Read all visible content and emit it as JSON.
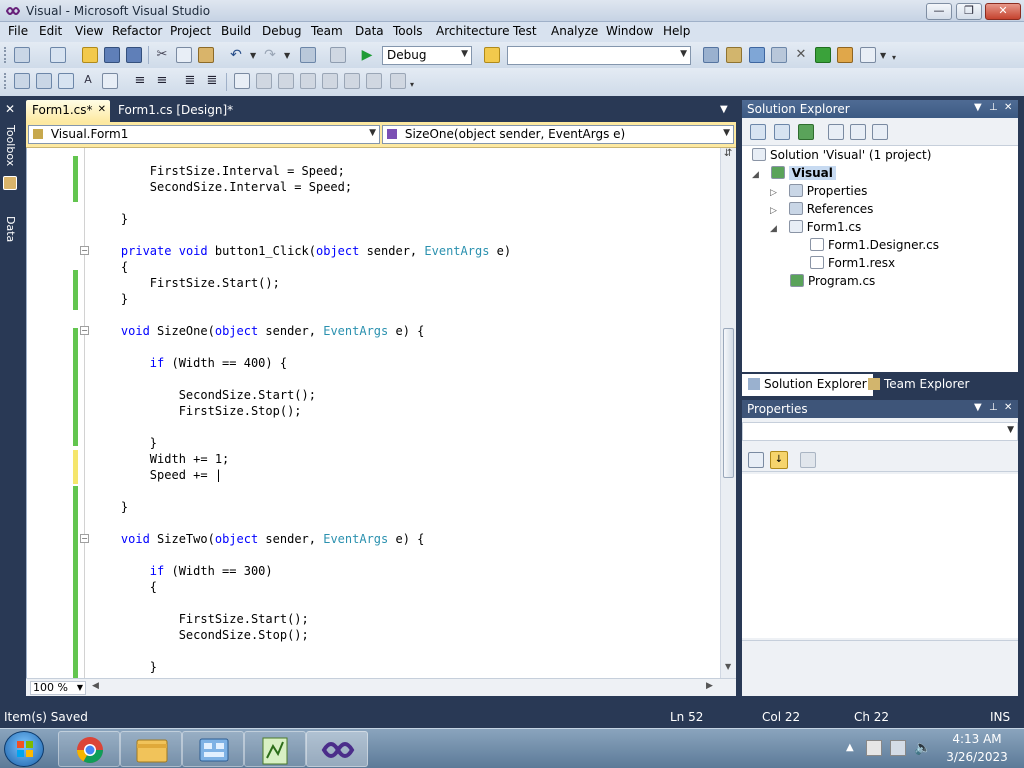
{
  "window": {
    "title": "Visual - Microsoft Visual Studio",
    "minimize": "—",
    "maximize": "❐",
    "close": "✕"
  },
  "menu": [
    "File",
    "Edit",
    "View",
    "Refactor",
    "Project",
    "Build",
    "Debug",
    "Team",
    "Data",
    "Tools",
    "Architecture",
    "Test",
    "Analyze",
    "Window",
    "Help"
  ],
  "toolbar": {
    "configuration": "Debug",
    "search_value": ""
  },
  "side_tabs": {
    "toolbox": "Toolbox",
    "data_sources": "Data Sources"
  },
  "doc_tabs": [
    {
      "label": "Form1.cs*",
      "close": "✕"
    },
    {
      "label": "Form1.cs [Design]*"
    }
  ],
  "navbar": {
    "class": "Visual.Form1",
    "member": "SizeOne(object sender, EventArgs e)"
  },
  "code": [
    {
      "line": "        FirstSize.Interval = Speed;"
    },
    {
      "line": "        SecondSize.Interval = Speed;"
    },
    {
      "line": ""
    },
    {
      "line": "    }"
    },
    {
      "line": ""
    },
    {
      "line": "    private void button1_Click(object sender, EventArgs e)"
    },
    {
      "line": "    {"
    },
    {
      "line": "        FirstSize.Start();"
    },
    {
      "line": "    }"
    },
    {
      "line": ""
    },
    {
      "line": "    void SizeOne(object sender, EventArgs e) {"
    },
    {
      "line": ""
    },
    {
      "line": "        if (Width == 400) {"
    },
    {
      "line": ""
    },
    {
      "line": "            SecondSize.Start();"
    },
    {
      "line": "            FirstSize.Stop();"
    },
    {
      "line": ""
    },
    {
      "line": "        }"
    },
    {
      "line": "        Width += 1;"
    },
    {
      "line": "        Speed += |"
    },
    {
      "line": ""
    },
    {
      "line": "    }"
    },
    {
      "line": ""
    },
    {
      "line": "    void SizeTwo(object sender, EventArgs e) {"
    },
    {
      "line": ""
    },
    {
      "line": "        if (Width == 300)"
    },
    {
      "line": "        {"
    },
    {
      "line": ""
    },
    {
      "line": "            FirstSize.Start();"
    },
    {
      "line": "            SecondSize.Stop();"
    },
    {
      "line": ""
    },
    {
      "line": "        }"
    }
  ],
  "zoom": "100 %",
  "solution_explorer": {
    "title": "Solution Explorer",
    "items": [
      {
        "label": "Solution 'Visual' (1 project)"
      },
      {
        "label": "Visual"
      },
      {
        "label": "Properties"
      },
      {
        "label": "References"
      },
      {
        "label": "Form1.cs"
      },
      {
        "label": "Form1.Designer.cs"
      },
      {
        "label": "Form1.resx"
      },
      {
        "label": "Program.cs"
      }
    ],
    "tabs": [
      "Solution Explorer",
      "Team Explorer"
    ]
  },
  "properties": {
    "title": "Properties"
  },
  "status": {
    "message": "Item(s) Saved",
    "ln": "Ln 52",
    "col": "Col 22",
    "ch": "Ch 22",
    "mode": "INS"
  },
  "taskbar": {
    "time": "4:13 AM",
    "date": "3/26/2023"
  },
  "colors": {
    "accent": "#293955",
    "doc_tab": "#fde9a1",
    "keyword": "#0000ff",
    "type": "#2b91af",
    "modified": "#63c54f"
  }
}
